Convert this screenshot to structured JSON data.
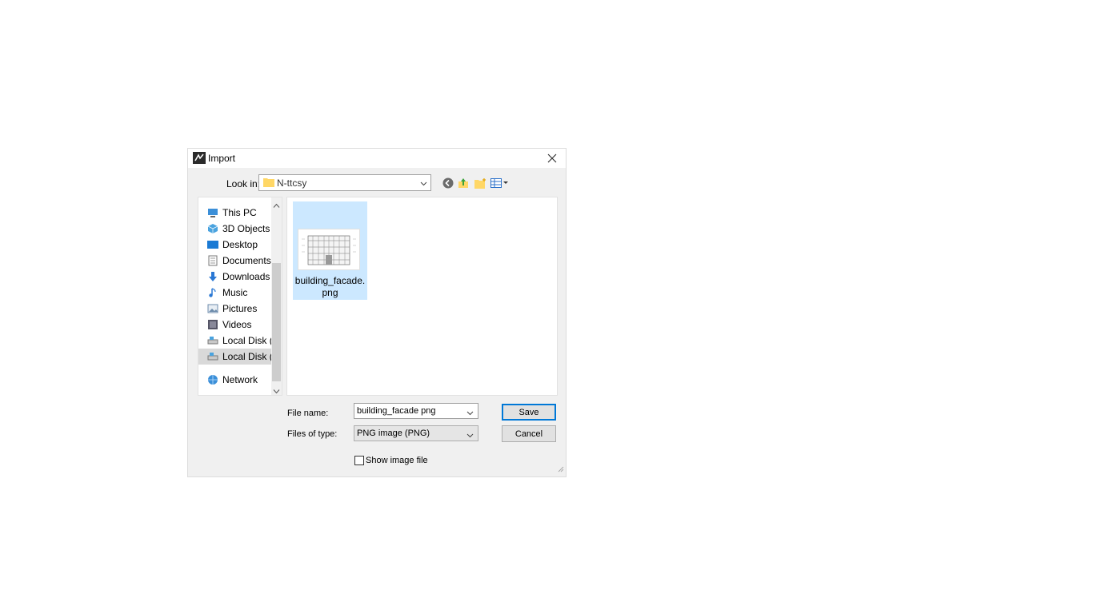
{
  "window": {
    "title": "Import",
    "close_icon": "close-icon"
  },
  "lookin": {
    "label": "Look in:",
    "value": "N-ttcsy"
  },
  "toolbar": {
    "icons": [
      "back-icon",
      "up-folder-icon",
      "new-folder-icon",
      "view-menu-icon"
    ]
  },
  "nav": {
    "items": [
      {
        "label": "This PC",
        "icon": "computer-icon"
      },
      {
        "label": "3D Objects",
        "icon": "3d-objects-icon"
      },
      {
        "label": "Desktop",
        "icon": "desktop-icon"
      },
      {
        "label": "Documents",
        "icon": "documents-icon"
      },
      {
        "label": "Downloads",
        "icon": "downloads-icon"
      },
      {
        "label": "Music",
        "icon": "music-icon"
      },
      {
        "label": "Pictures",
        "icon": "pictures-icon"
      },
      {
        "label": "Videos",
        "icon": "videos-icon"
      },
      {
        "label": "Local Disk (C",
        "icon": "drive-icon"
      },
      {
        "label": "Local Disk (F",
        "icon": "drive-icon",
        "selected": true
      },
      {
        "label": "Network",
        "icon": "network-icon"
      }
    ]
  },
  "files": [
    {
      "name": "building_facade.\npng",
      "icon": "image-thumbnail",
      "selected": true
    }
  ],
  "form": {
    "filename_label": "File name:",
    "filename_value": "building_facade png",
    "filetype_label": "Files of type:",
    "filetype_value": "PNG image (PNG)",
    "save_label": "Save",
    "cancel_label": "Cancel",
    "show_image_label": "Show image file",
    "show_image_checked": false
  },
  "colors": {
    "selection": "#cce8ff",
    "accent": "#0078d7",
    "dialog_bg": "#f0f0f0"
  }
}
